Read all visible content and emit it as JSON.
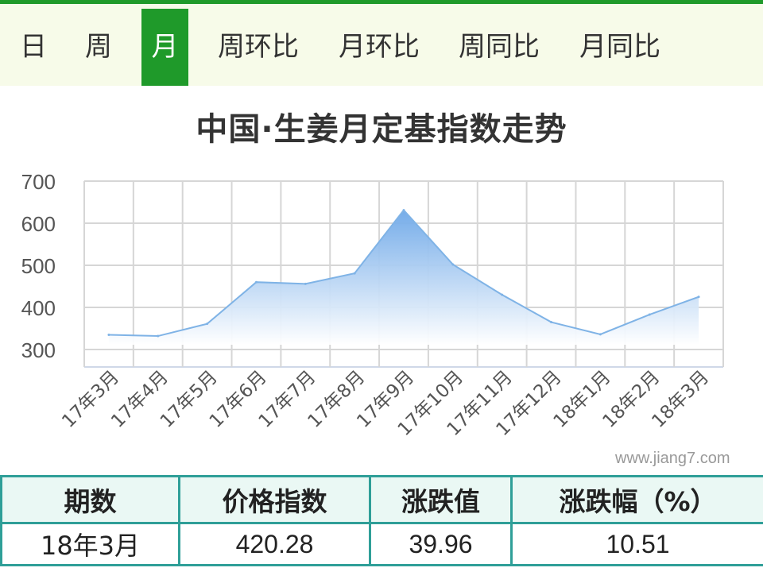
{
  "tabs": [
    {
      "label": "日",
      "active": false
    },
    {
      "label": "周",
      "active": false
    },
    {
      "label": "月",
      "active": true
    },
    {
      "label": "周环比",
      "active": false
    },
    {
      "label": "月环比",
      "active": false
    },
    {
      "label": "周同比",
      "active": false
    },
    {
      "label": "月同比",
      "active": false
    }
  ],
  "watermark": "www.jiang7.com",
  "colors": {
    "accent": "#1f9a2a",
    "tab_bg": "#f7fbe9",
    "line": "#7fb3e6",
    "area_top": "#6ea8e8",
    "table_border": "#2f9f98",
    "table_header_bg": "#eaf8f4"
  },
  "chart_data": {
    "type": "area",
    "title": "中国·生姜月定基指数走势",
    "categories": [
      "17年3月",
      "17年4月",
      "17年5月",
      "17年6月",
      "17年7月",
      "17年8月",
      "17年9月",
      "17年10月",
      "17年11月",
      "17年12月",
      "18年1月",
      "18年2月",
      "18年3月"
    ],
    "series": [
      {
        "values": [
          335,
          332,
          361,
          460,
          456,
          481,
          631,
          502,
          430,
          365,
          336,
          383,
          425
        ]
      }
    ],
    "y_ticks": [
      300,
      400,
      500,
      600,
      700
    ],
    "ylim": [
      300,
      700
    ],
    "grid": true
  },
  "table": {
    "headers": [
      "期数",
      "价格指数",
      "涨跌值",
      "涨跌幅（%）"
    ],
    "row": [
      "18年3月",
      "420.28",
      "39.96",
      "10.51"
    ]
  }
}
